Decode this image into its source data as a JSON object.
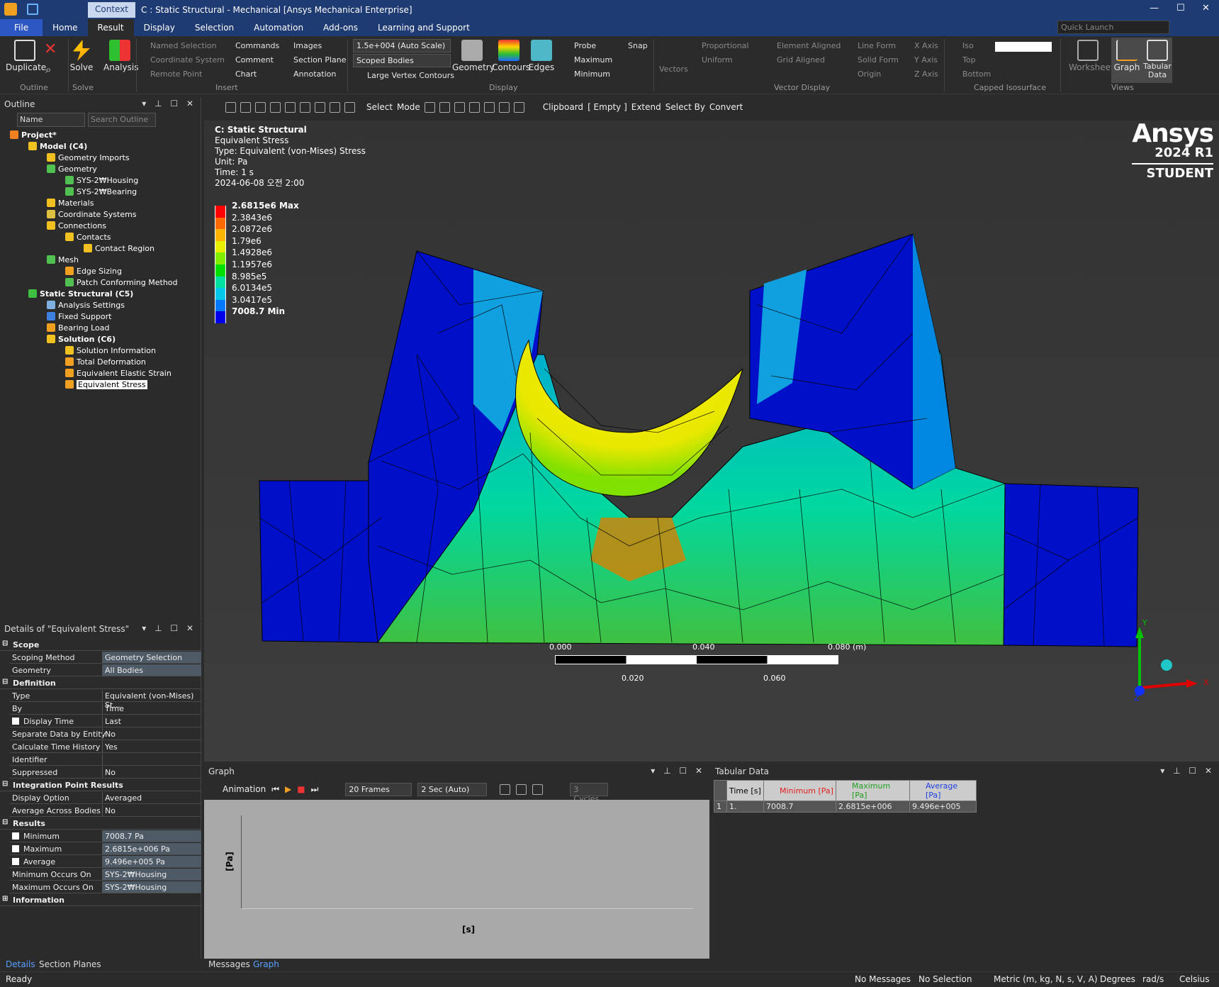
{
  "titlebar": {
    "context": "Context",
    "title": "C : Static Structural - Mechanical [Ansys Mechanical Enterprise]",
    "window_buttons": [
      "—",
      "☐",
      "✕"
    ]
  },
  "menu": {
    "tabs": [
      "File",
      "Home",
      "Result",
      "Display",
      "Selection",
      "Automation",
      "Add-ons",
      "Learning and Support"
    ],
    "active": "Result",
    "quick_launch_placeholder": "Quick Launch"
  },
  "ribbon": {
    "outline": {
      "duplicate": "Duplicate",
      "group": "Outline"
    },
    "solve": {
      "label": "Solve",
      "group": "Solve"
    },
    "analysis": {
      "label": "Analysis"
    },
    "insert": {
      "named_selection": "Named Selection",
      "coordinate_system": "Coordinate System",
      "remote_point": "Remote Point",
      "commands": "Commands",
      "comment": "Comment",
      "chart": "Chart",
      "images": "Images",
      "section_plane": "Section Plane",
      "annotation": "Annotation",
      "group": "Insert"
    },
    "display": {
      "scale": "1.5e+004 (Auto Scale)",
      "scoped": "Scoped Bodies",
      "large_vertex": "Large Vertex Contours",
      "geometry": "Geometry",
      "contours": "Contours",
      "edges": "Edges",
      "probe": "Probe",
      "maximum": "Maximum",
      "minimum": "Minimum",
      "snap": "Snap",
      "group": "Display"
    },
    "vector": {
      "vectors": "Vectors",
      "proportional": "Proportional",
      "uniform": "Uniform",
      "element_aligned": "Element Aligned",
      "grid_aligned": "Grid Aligned",
      "line_form": "Line Form",
      "solid_form": "Solid Form",
      "origin": "Origin",
      "x_axis": "X Axis",
      "y_axis": "Y Axis",
      "z_axis": "Z Axis",
      "group": "Vector Display"
    },
    "capped": {
      "iso": "Iso",
      "top": "Top",
      "bottom": "Bottom",
      "group": "Capped Isosurface"
    },
    "views": {
      "worksheet": "Worksheet",
      "graph": "Graph",
      "tabular": "Tabular Data",
      "group": "Views"
    }
  },
  "toolbar": {
    "select": "Select",
    "mode": "Mode",
    "clipboard": "Clipboard",
    "empty": "[ Empty ]",
    "extend": "Extend",
    "select_by": "Select By",
    "convert": "Convert"
  },
  "outline": {
    "title": "Outline",
    "filter_name": "Name",
    "search_placeholder": "Search Outline",
    "nodes": [
      {
        "label": "Project*",
        "bold": true
      },
      {
        "label": "Model (C4)",
        "bold": true
      },
      {
        "label": "Geometry Imports"
      },
      {
        "label": "Geometry"
      },
      {
        "label": "SYS-2₩Housing"
      },
      {
        "label": "SYS-2₩Bearing"
      },
      {
        "label": "Materials"
      },
      {
        "label": "Coordinate Systems"
      },
      {
        "label": "Connections"
      },
      {
        "label": "Contacts"
      },
      {
        "label": "Contact Region"
      },
      {
        "label": "Mesh"
      },
      {
        "label": "Edge Sizing"
      },
      {
        "label": "Patch Conforming Method"
      },
      {
        "label": "Static Structural (C5)",
        "bold": true
      },
      {
        "label": "Analysis Settings"
      },
      {
        "label": "Fixed Support"
      },
      {
        "label": "Bearing Load"
      },
      {
        "label": "Solution (C6)",
        "bold": true
      },
      {
        "label": "Solution Information"
      },
      {
        "label": "Total Deformation"
      },
      {
        "label": "Equivalent Elastic Strain"
      },
      {
        "label": "Equivalent Stress",
        "selected": true
      }
    ]
  },
  "details": {
    "title": "Details of \"Equivalent Stress\"",
    "rows": [
      {
        "k": "Scope",
        "sec": true
      },
      {
        "k": "Scoping Method",
        "v": "Geometry Selection",
        "hl": true
      },
      {
        "k": "Geometry",
        "v": "All Bodies",
        "hl": true
      },
      {
        "k": "Definition",
        "sec": true
      },
      {
        "k": "Type",
        "v": "Equivalent (von-Mises) St..."
      },
      {
        "k": "By",
        "v": "Time"
      },
      {
        "k": "Display Time",
        "v": "Last",
        "cb": true
      },
      {
        "k": "Separate Data by Entity",
        "v": "No"
      },
      {
        "k": "Calculate Time History",
        "v": "Yes"
      },
      {
        "k": "Identifier",
        "v": ""
      },
      {
        "k": "Suppressed",
        "v": "No"
      },
      {
        "k": "Integration Point Results",
        "sec": true
      },
      {
        "k": "Display Option",
        "v": "Averaged"
      },
      {
        "k": "Average Across Bodies",
        "v": "No"
      },
      {
        "k": "Results",
        "sec": true
      },
      {
        "k": "Minimum",
        "v": "7008.7 Pa",
        "cb": true,
        "hl": true
      },
      {
        "k": "Maximum",
        "v": "2.6815e+006 Pa",
        "cb": true,
        "hl": true
      },
      {
        "k": "Average",
        "v": "9.496e+005 Pa",
        "cb": true,
        "hl": true
      },
      {
        "k": "Minimum Occurs On",
        "v": "SYS-2₩Housing",
        "hl": true
      },
      {
        "k": "Maximum Occurs On",
        "v": "SYS-2₩Housing",
        "hl": true
      },
      {
        "k": "Information",
        "sec": true
      }
    ]
  },
  "viewport": {
    "header": [
      "C: Static Structural",
      "Equivalent Stress",
      "Type: Equivalent (von-Mises) Stress",
      "Unit: Pa",
      "Time: 1 s",
      "2024-06-08 오전 2:00"
    ],
    "brand": "Ansys",
    "version": "2024 R1",
    "edition": "STUDENT",
    "legend": [
      {
        "v": "2.6815e6 Max",
        "c": "#ff0000",
        "bold": true
      },
      {
        "v": "2.3843e6",
        "c": "#ff6a00"
      },
      {
        "v": "2.0872e6",
        "c": "#ffb400"
      },
      {
        "v": "1.79e6",
        "c": "#e8f000"
      },
      {
        "v": "1.4928e6",
        "c": "#80f000"
      },
      {
        "v": "1.1957e6",
        "c": "#00e000"
      },
      {
        "v": "8.985e5",
        "c": "#00e0a0"
      },
      {
        "v": "6.0134e5",
        "c": "#00c8e8"
      },
      {
        "v": "3.0417e5",
        "c": "#0078ff"
      },
      {
        "v": "7008.7 Min",
        "c": "#0000e8",
        "bold": true
      }
    ],
    "scale": {
      "top": [
        "0.000",
        "0.040",
        "0.080 (m)"
      ],
      "bottom": [
        "0.020",
        "0.060"
      ]
    },
    "triad": {
      "x": "X",
      "y": "Y",
      "z": "Z"
    }
  },
  "graph": {
    "title": "Graph",
    "animation": "Animation",
    "frames": "20 Frames",
    "duration": "2 Sec (Auto)",
    "cycles": "3 Cycles",
    "ylabel": "[Pa]",
    "xlabel": "[s]"
  },
  "tabular": {
    "title": "Tabular Data",
    "headers": [
      "Time [s]",
      "Minimum [Pa]",
      "Maximum [Pa]",
      "Average [Pa]"
    ],
    "row": [
      "1",
      "1.",
      "7008.7",
      "2.6815e+006",
      "9.496e+005"
    ]
  },
  "bottom_tabs": {
    "left": [
      "Details",
      "Section Planes"
    ],
    "mid": [
      "Messages",
      "Graph"
    ]
  },
  "status": {
    "ready": "Ready",
    "messages": "No Messages",
    "selection": "No Selection",
    "units": "Metric (m, kg, N, s, V, A)",
    "degrees": "Degrees",
    "rads": "rad/s",
    "temp": "Celsius"
  }
}
